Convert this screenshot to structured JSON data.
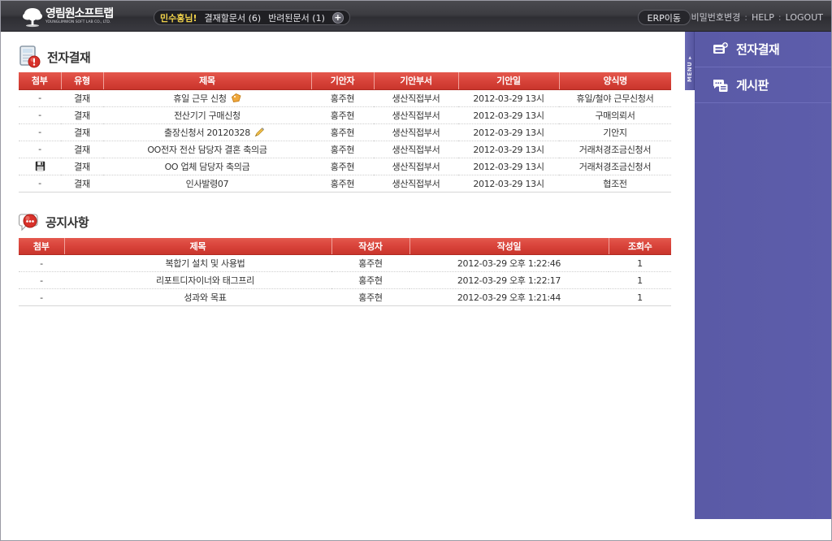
{
  "topbar": {
    "logo_main": "영림원소프트랩",
    "logo_sub": "YOUNGLIMWON SOFT LAB CO., LTD.",
    "greeting": "민수홍님!",
    "nav_approve": "결재할문서 (6)",
    "nav_returned": "반려된문서 (1)",
    "plus": "+",
    "erp_button": "ERP이동",
    "link_password": "비밀번호변경",
    "sep1": ":",
    "link_help": "HELP",
    "sep2": ":",
    "link_logout": "LOGOUT"
  },
  "approval": {
    "section_title": "전자결재",
    "icon": "document-alert-icon",
    "columns": [
      "첨부",
      "유형",
      "제목",
      "기안자",
      "기안부서",
      "기안일",
      "양식명"
    ],
    "rows": [
      {
        "attach": "-",
        "attach_icon": "",
        "type": "결재",
        "title": "휴일 근무 신청",
        "title_icon": "tag-icon",
        "writer": "홍주현",
        "dept": "생산직접부서",
        "date": "2012-03-29 13시",
        "form": "휴일/철야 근무신청서"
      },
      {
        "attach": "-",
        "attach_icon": "",
        "type": "결재",
        "title": "전산기기 구매신청",
        "title_icon": "",
        "writer": "홍주현",
        "dept": "생산직접부서",
        "date": "2012-03-29 13시",
        "form": "구매의뢰서"
      },
      {
        "attach": "-",
        "attach_icon": "",
        "type": "결재",
        "title": "출장신청서 20120328",
        "title_icon": "pencil-icon",
        "writer": "홍주현",
        "dept": "생산직접부서",
        "date": "2012-03-29 13시",
        "form": "기안지"
      },
      {
        "attach": "-",
        "attach_icon": "",
        "type": "결재",
        "title": "OO전자 전산 담당자 결혼 축의금",
        "title_icon": "",
        "writer": "홍주현",
        "dept": "생산직접부서",
        "date": "2012-03-29 13시",
        "form": "거래처경조금신청서"
      },
      {
        "attach": "",
        "attach_icon": "floppy-disk-icon",
        "type": "결재",
        "title": "OO 업체 담당자 축의금",
        "title_icon": "",
        "writer": "홍주현",
        "dept": "생산직접부서",
        "date": "2012-03-29 13시",
        "form": "거래처경조금신청서"
      },
      {
        "attach": "-",
        "attach_icon": "",
        "type": "결재",
        "title": "인사발령07",
        "title_icon": "",
        "writer": "홍주현",
        "dept": "생산직접부서",
        "date": "2012-03-29 13시",
        "form": "협조전"
      }
    ]
  },
  "notice": {
    "section_title": "공지사항",
    "icon": "speech-bubble-icon",
    "columns": [
      "첨부",
      "제목",
      "작성자",
      "작성일",
      "조회수"
    ],
    "rows": [
      {
        "attach": "-",
        "title": "복합기 설치 및 사용법",
        "writer": "홍주현",
        "date": "2012-03-29 오후 1:22:46",
        "views": "1"
      },
      {
        "attach": "-",
        "title": "리포트디자이너와 태그프리",
        "writer": "홍주현",
        "date": "2012-03-29 오후 1:22:17",
        "views": "1"
      },
      {
        "attach": "-",
        "title": "성과와 목표",
        "writer": "홍주현",
        "date": "2012-03-29 오후 1:21:44",
        "views": "1"
      }
    ]
  },
  "sidebar": {
    "menu_tab_label": "MENU ▸",
    "items": [
      {
        "label": "전자결재",
        "icon": "approval-card-icon"
      },
      {
        "label": "게시판",
        "icon": "board-bubble-icon"
      }
    ]
  },
  "colors": {
    "header_red": "#d8433a",
    "sidebar_purple": "#5b5ba8",
    "topbar_dark": "#3c3c41",
    "greeting_yellow": "#f0d24a"
  }
}
